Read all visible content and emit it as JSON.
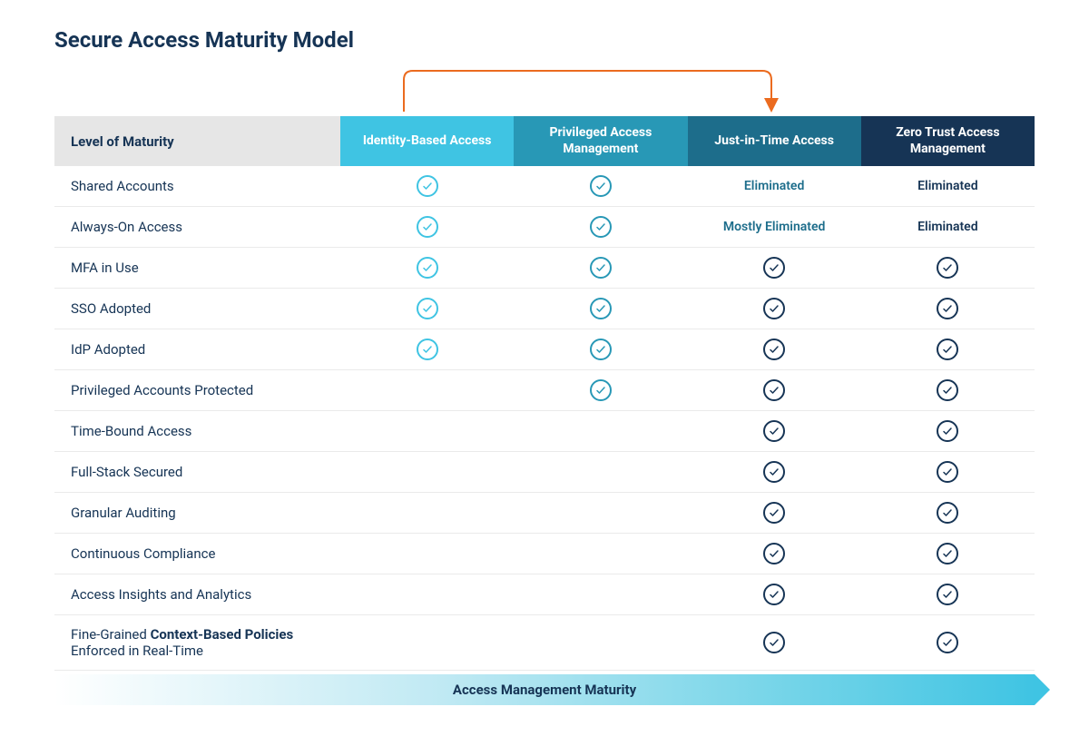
{
  "title": "Secure Access Maturity Model",
  "labelHeader": "Level of Maturity",
  "footer": "Access Management Maturity",
  "colors": {
    "col0": "#3fc4e3",
    "col1": "#2898b6",
    "col2": "#1d6d8b",
    "col3": "#163455",
    "arrow": "#eb6b1f"
  },
  "columns": [
    "Identity-Based Access",
    "Privileged Access Management",
    "Just-in-Time Access",
    "Zero Trust Access Management"
  ],
  "rows": [
    {
      "label": "Shared Accounts",
      "cells": [
        {
          "type": "check",
          "variant": "light"
        },
        {
          "type": "check",
          "variant": "medium"
        },
        {
          "type": "text",
          "text": "Eliminated",
          "tone": "teal"
        },
        {
          "type": "text",
          "text": "Eliminated",
          "tone": "navy"
        }
      ]
    },
    {
      "label": "Always-On Access",
      "cells": [
        {
          "type": "check",
          "variant": "light"
        },
        {
          "type": "check",
          "variant": "medium"
        },
        {
          "type": "text",
          "text": "Mostly Eliminated",
          "tone": "teal"
        },
        {
          "type": "text",
          "text": "Eliminated",
          "tone": "navy"
        }
      ]
    },
    {
      "label": "MFA in Use",
      "cells": [
        {
          "type": "check",
          "variant": "light"
        },
        {
          "type": "check",
          "variant": "medium"
        },
        {
          "type": "check",
          "variant": "dark"
        },
        {
          "type": "check",
          "variant": "dark"
        }
      ]
    },
    {
      "label": "SSO Adopted",
      "cells": [
        {
          "type": "check",
          "variant": "light"
        },
        {
          "type": "check",
          "variant": "medium"
        },
        {
          "type": "check",
          "variant": "dark"
        },
        {
          "type": "check",
          "variant": "dark"
        }
      ]
    },
    {
      "label": "IdP Adopted",
      "cells": [
        {
          "type": "check",
          "variant": "light"
        },
        {
          "type": "check",
          "variant": "medium"
        },
        {
          "type": "check",
          "variant": "dark"
        },
        {
          "type": "check",
          "variant": "dark"
        }
      ]
    },
    {
      "label": "Privileged Accounts Protected",
      "cells": [
        {
          "type": "empty"
        },
        {
          "type": "check",
          "variant": "medium"
        },
        {
          "type": "check",
          "variant": "dark"
        },
        {
          "type": "check",
          "variant": "dark"
        }
      ]
    },
    {
      "label": "Time-Bound Access",
      "cells": [
        {
          "type": "empty"
        },
        {
          "type": "empty"
        },
        {
          "type": "check",
          "variant": "dark"
        },
        {
          "type": "check",
          "variant": "dark"
        }
      ]
    },
    {
      "label": "Full-Stack Secured",
      "cells": [
        {
          "type": "empty"
        },
        {
          "type": "empty"
        },
        {
          "type": "check",
          "variant": "dark"
        },
        {
          "type": "check",
          "variant": "dark"
        }
      ]
    },
    {
      "label": "Granular Auditing",
      "cells": [
        {
          "type": "empty"
        },
        {
          "type": "empty"
        },
        {
          "type": "check",
          "variant": "dark"
        },
        {
          "type": "check",
          "variant": "dark"
        }
      ]
    },
    {
      "label": "Continuous Compliance",
      "cells": [
        {
          "type": "empty"
        },
        {
          "type": "empty"
        },
        {
          "type": "check",
          "variant": "dark"
        },
        {
          "type": "check",
          "variant": "dark"
        }
      ]
    },
    {
      "label": "Access Insights and Analytics",
      "cells": [
        {
          "type": "empty"
        },
        {
          "type": "empty"
        },
        {
          "type": "check",
          "variant": "dark"
        },
        {
          "type": "check",
          "variant": "dark"
        }
      ]
    },
    {
      "label": "Fine-Grained Context-Based Policies Enforced in Real-Time",
      "labelParts": [
        "Fine-Grained ",
        "Context-Based Policies",
        " Enforced in Real-Time"
      ],
      "cells": [
        {
          "type": "empty"
        },
        {
          "type": "empty"
        },
        {
          "type": "check",
          "variant": "dark"
        },
        {
          "type": "check",
          "variant": "dark"
        }
      ]
    }
  ]
}
